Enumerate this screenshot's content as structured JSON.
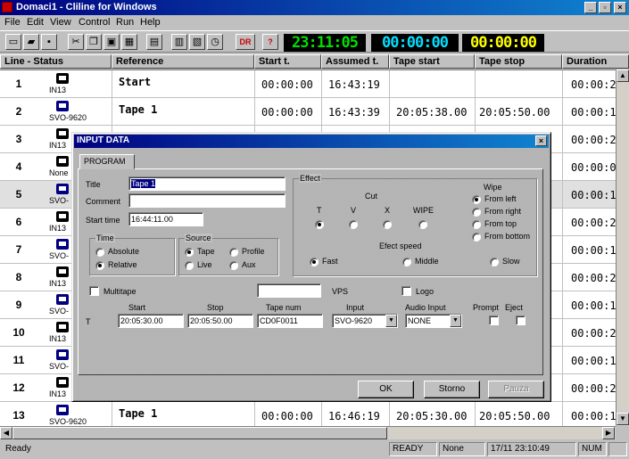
{
  "window": {
    "title": "Domaci1 - Cliline for Windows"
  },
  "menu": [
    "File",
    "Edit",
    "View",
    "Control",
    "Run",
    "Help"
  ],
  "toolbar": {
    "dr_label": "DR",
    "help_label": "?",
    "clock_main": "23:11:05",
    "clock_cyan": "00:00:00",
    "clock_yellow": "00:00:00"
  },
  "columns": [
    "Line - Status",
    "Reference",
    "Start t.",
    "Assumed t.",
    "Tape start",
    "Tape stop",
    "Duration"
  ],
  "rows": [
    {
      "num": "1",
      "status": "IN13",
      "ref": "Start",
      "start": "00:00:00",
      "assumed": "16:43:19",
      "tstart": "",
      "tstop": "",
      "dur": "00:00:2"
    },
    {
      "num": "2",
      "status": "SVO-9620",
      "ref": "Tape 1",
      "start": "00:00:00",
      "assumed": "16:43:39",
      "tstart": "20:05:38.00",
      "tstop": "20:05:50.00",
      "dur": "00:00:1"
    },
    {
      "num": "3",
      "status": "IN13",
      "ref": "",
      "start": "",
      "assumed": "",
      "tstart": "",
      "tstop": "",
      "dur": "00:00:2"
    },
    {
      "num": "4",
      "status": "None",
      "ref": "",
      "start": "",
      "assumed": "",
      "tstart": "",
      "tstop": "",
      "dur": "00:00:0"
    },
    {
      "num": "5",
      "status": "SVO-",
      "ref": "",
      "start": "",
      "assumed": "",
      "tstart": "",
      "tstop": "",
      "dur": "00:00:1"
    },
    {
      "num": "6",
      "status": "IN13",
      "ref": "",
      "start": "",
      "assumed": "",
      "tstart": "",
      "tstop": "",
      "dur": "00:00:2"
    },
    {
      "num": "7",
      "status": "SVO-",
      "ref": "",
      "start": "",
      "assumed": "",
      "tstart": "",
      "tstop": "",
      "dur": "00:00:1"
    },
    {
      "num": "8",
      "status": "IN13",
      "ref": "",
      "start": "",
      "assumed": "",
      "tstart": "",
      "tstop": "",
      "dur": "00:00:2"
    },
    {
      "num": "9",
      "status": "SVO-",
      "ref": "",
      "start": "",
      "assumed": "",
      "tstart": "",
      "tstop": "",
      "dur": "00:00:1"
    },
    {
      "num": "10",
      "status": "IN13",
      "ref": "",
      "start": "",
      "assumed": "",
      "tstart": "",
      "tstop": "",
      "dur": "00:00:2"
    },
    {
      "num": "11",
      "status": "SVO-",
      "ref": "",
      "start": "",
      "assumed": "",
      "tstart": "",
      "tstop": "",
      "dur": "00:00:1"
    },
    {
      "num": "12",
      "status": "IN13",
      "ref": "",
      "start": "",
      "assumed": "",
      "tstart": "",
      "tstop": "",
      "dur": "00:00:2"
    },
    {
      "num": "13",
      "status": "SVO-9620",
      "ref": "Tape 1",
      "start": "00:00:00",
      "assumed": "16:46:19",
      "tstart": "20:05:30.00",
      "tstop": "20:05:50.00",
      "dur": "00:00:1"
    }
  ],
  "statusbar": {
    "left": "Ready",
    "state": "READY",
    "mode": "None",
    "datetime": "17/11 23:10:49",
    "num": "NUM"
  },
  "dialog": {
    "title": "INPUT DATA",
    "tab": "PROGRAM",
    "title_label": "Title",
    "title_value": "Tape 1",
    "comment_label": "Comment",
    "comment_value": "",
    "start_label": "Start time",
    "start_value": "16:44:11.00",
    "time_group": "Time",
    "time_absolute": "Absolute",
    "time_relative": "Relative",
    "source_group": "Source",
    "source_tape": "Tape",
    "source_profile": "Profile",
    "source_live": "Live",
    "source_aux": "Aux",
    "effect_group": "Effect",
    "cut_label": "Cut",
    "wipe_label": "Wipe",
    "fx_t": "T",
    "fx_v": "V",
    "fx_x": "X",
    "fx_wipe": "WIPE",
    "wipe_left": "From left",
    "wipe_right": "From right",
    "wipe_top": "From top",
    "wipe_bottom": "From bottom",
    "speed_label": "Efect speed",
    "speed_fast": "Fast",
    "speed_middle": "Middle",
    "speed_slow": "Slow",
    "multitape": "Multitape",
    "vps_label": "VPS",
    "logo": "Logo",
    "col_start": "Start",
    "col_stop": "Stop",
    "col_tapenum": "Tape num",
    "col_input": "Input",
    "col_audio": "Audio Input",
    "col_prompt": "Prompt",
    "col_eject": "Eject",
    "row_t": "T",
    "val_start": "20:05:30.00",
    "val_stop": "20:05:50.00",
    "val_tapenum": "CD0F0011",
    "val_input": "SVO-9620",
    "val_audio": "NONE",
    "ok": "OK",
    "cancel": "Storno",
    "pause": "Pauza"
  }
}
